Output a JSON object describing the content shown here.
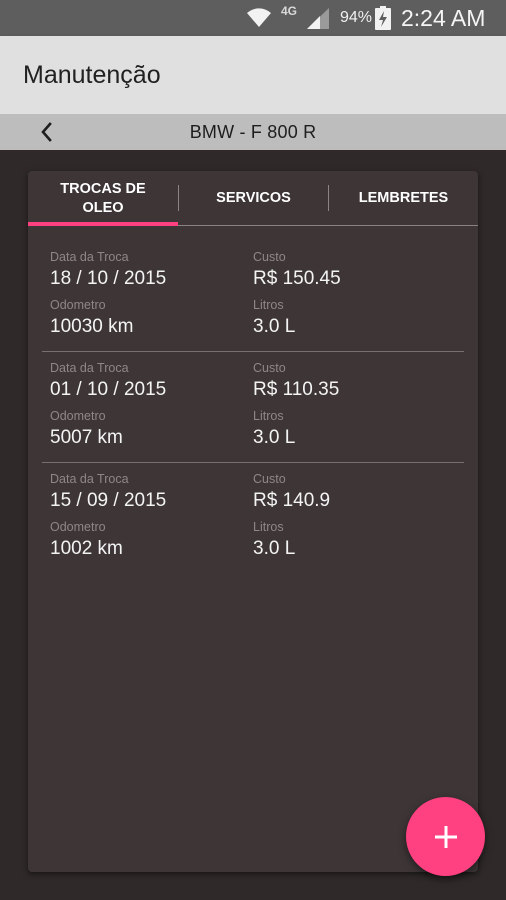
{
  "status_bar": {
    "network": "4G",
    "battery_percent": "94%",
    "time": "2:24 AM",
    "icons": [
      "wifi-icon",
      "signal-icon",
      "battery-charging-icon"
    ]
  },
  "app_bar": {
    "title": "Manutenção"
  },
  "vehicle_bar": {
    "back_icon": "chevron-left-icon",
    "vehicle_name": "BMW - F 800 R"
  },
  "tabs": [
    {
      "label": "TROCAS DE\nOLEO",
      "selected": true
    },
    {
      "label": "SERVICOS",
      "selected": false
    },
    {
      "label": "LEMBRETES",
      "selected": false
    }
  ],
  "entries": [
    {
      "date_label": "Data da Troca",
      "date": "18 / 10 / 2015",
      "cost_label": "Custo",
      "cost": "R$ 150.45",
      "odometer_label": "Odometro",
      "odometer": "10030 km",
      "liters_label": "Litros",
      "liters": "3.0 L"
    },
    {
      "date_label": "Data da Troca",
      "date": "01 / 10 / 2015",
      "cost_label": "Custo",
      "cost": "R$ 110.35",
      "odometer_label": "Odometro",
      "odometer": "5007 km",
      "liters_label": "Litros",
      "liters": "3.0 L"
    },
    {
      "date_label": "Data da Troca",
      "date": "15 / 09 / 2015",
      "cost_label": "Custo",
      "cost": "R$ 140.9",
      "odometer_label": "Odometro",
      "odometer": "1002 km",
      "liters_label": "Litros",
      "liters": "3.0 L"
    }
  ],
  "fab": {
    "icon": "plus-icon"
  },
  "colors": {
    "accent": "#ff4081",
    "background": "#2f2929",
    "card": "#3e3636",
    "app_bar": "#e0e0e0",
    "vehicle_bar": "#bdbdbd"
  }
}
